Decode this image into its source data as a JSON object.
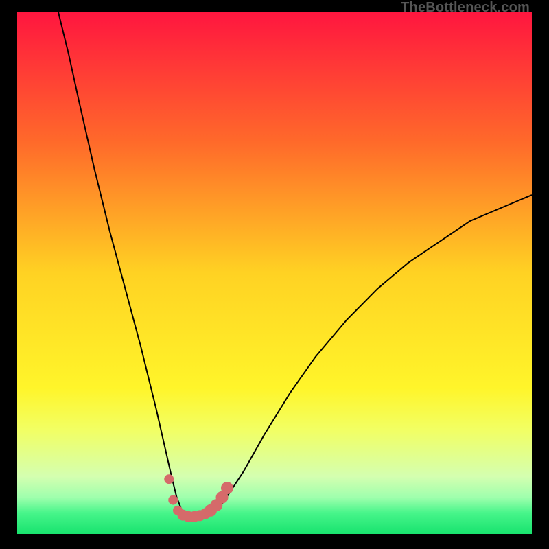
{
  "watermark": "TheBottleneck.com",
  "chart_data": {
    "type": "line",
    "title": "",
    "xlabel": "",
    "ylabel": "",
    "xlim": [
      0,
      100
    ],
    "ylim": [
      0,
      100
    ],
    "grid": false,
    "legend": false,
    "background": {
      "type": "vertical-gradient",
      "stops": [
        {
          "offset": 0,
          "color": "#ff163f"
        },
        {
          "offset": 0.25,
          "color": "#ff6a2a"
        },
        {
          "offset": 0.5,
          "color": "#ffd223"
        },
        {
          "offset": 0.72,
          "color": "#fff52a"
        },
        {
          "offset": 0.8,
          "color": "#f2ff63"
        },
        {
          "offset": 0.89,
          "color": "#d4ffb0"
        },
        {
          "offset": 0.93,
          "color": "#9fffad"
        },
        {
          "offset": 0.96,
          "color": "#47f58a"
        },
        {
          "offset": 1.0,
          "color": "#18e36e"
        }
      ]
    },
    "series": [
      {
        "name": "curve",
        "x": [
          8,
          10,
          12,
          15,
          18,
          21,
          24,
          27,
          30,
          31,
          32,
          33,
          34,
          36,
          38,
          40,
          44,
          48,
          53,
          58,
          64,
          70,
          76,
          82,
          88,
          94,
          100
        ],
        "y": [
          100,
          92,
          83,
          70,
          58,
          47,
          36,
          24,
          11,
          7,
          4.5,
          3.5,
          3.3,
          3.3,
          4,
          6,
          12,
          19,
          27,
          34,
          41,
          47,
          52,
          56,
          60,
          62.5,
          65
        ],
        "stroke": "#000000",
        "stroke_width": 2
      },
      {
        "name": "overlay-dots",
        "type": "scatter",
        "marker_color": "#d56a6a",
        "points": [
          {
            "x": 29.5,
            "y": 10.5,
            "r": 7
          },
          {
            "x": 30.3,
            "y": 6.5,
            "r": 7
          },
          {
            "x": 31.2,
            "y": 4.5,
            "r": 7
          },
          {
            "x": 32.2,
            "y": 3.6,
            "r": 8
          },
          {
            "x": 33.3,
            "y": 3.3,
            "r": 8
          },
          {
            "x": 34.4,
            "y": 3.3,
            "r": 8
          },
          {
            "x": 35.5,
            "y": 3.5,
            "r": 8
          },
          {
            "x": 36.6,
            "y": 3.9,
            "r": 8
          },
          {
            "x": 37.6,
            "y": 4.5,
            "r": 9
          },
          {
            "x": 38.7,
            "y": 5.5,
            "r": 9
          },
          {
            "x": 39.8,
            "y": 7.0,
            "r": 9
          },
          {
            "x": 40.8,
            "y": 8.8,
            "r": 9
          }
        ]
      }
    ]
  }
}
